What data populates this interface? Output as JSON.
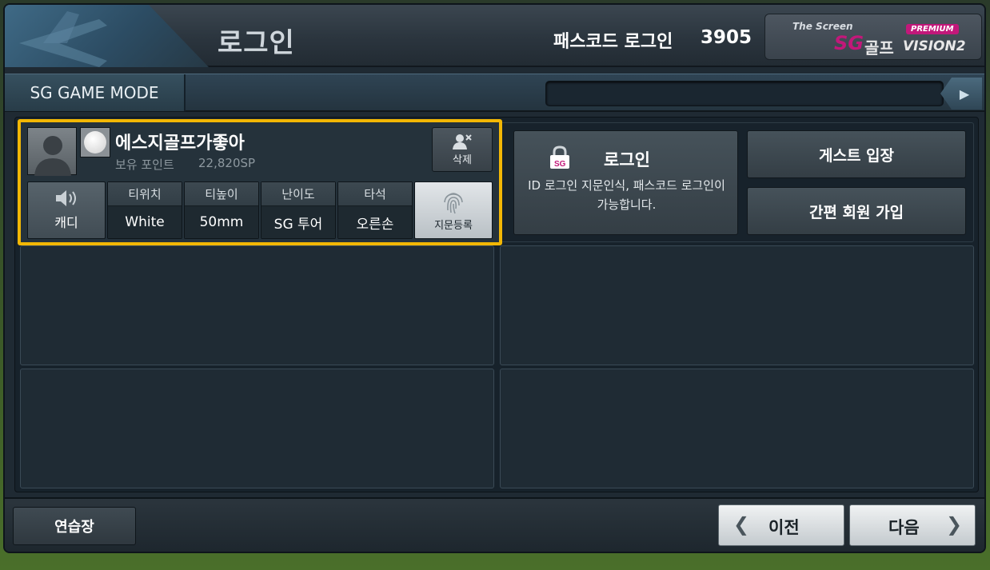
{
  "header": {
    "title": "로그인",
    "passcode_label": "패스코드 로그인",
    "passcode_value": "3905",
    "brand": {
      "the_screen": "The Screen",
      "sg": "SG",
      "golf": "골프",
      "premium": "PREMIUM",
      "vision": "VISION2"
    }
  },
  "mode_bar": {
    "label": "SG GAME MODE",
    "play_icon": "play-icon"
  },
  "player": {
    "name": "에스지골프가좋아",
    "points_label": "보유 포인트",
    "points_value": "22,820SP",
    "delete_label": "삭제",
    "caddy_label": "캐디",
    "options": [
      {
        "header": "티위치",
        "value": "White"
      },
      {
        "header": "티높이",
        "value": "50mm"
      },
      {
        "header": "난이도",
        "value": "SG 투어"
      },
      {
        "header": "타석",
        "value": "오른손"
      }
    ],
    "fingerprint_label": "지문등록",
    "highlight_color": "#f2b705"
  },
  "login_panel": {
    "title": "로그인",
    "description": "ID 로그인 지문인식, 패스코드 로그인이 가능합니다.",
    "icon_text": "SG"
  },
  "right_buttons": {
    "guest": "게스트 입장",
    "signup": "간편 회원 가입"
  },
  "bottom": {
    "practice": "연습장",
    "prev": "이전",
    "next": "다음",
    "prev_chevron": "❮",
    "next_chevron": "❯"
  }
}
